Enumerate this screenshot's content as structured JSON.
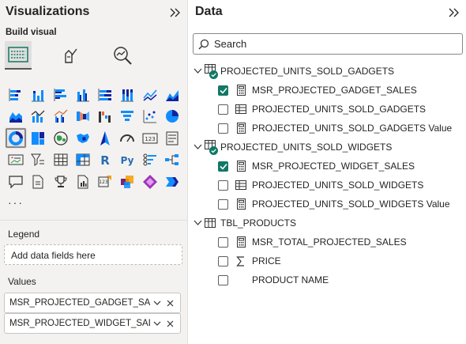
{
  "visualizations": {
    "title": "Visualizations",
    "build_visual_label": "Build visual",
    "more_label": "···",
    "legend": {
      "label": "Legend",
      "placeholder": "Add data fields here"
    },
    "values": {
      "label": "Values",
      "fields": [
        "MSR_PROJECTED_GADGET_SALES",
        "MSR_PROJECTED_WIDGET_SALES"
      ]
    },
    "selected_visual": "donut-chart-icon"
  },
  "data": {
    "title": "Data",
    "search_placeholder": "Search",
    "tables": [
      {
        "name": "PROJECTED_UNITS_SOLD_GADGETS",
        "fields": [
          {
            "label": "MSR_PROJECTED_GADGET_SALES",
            "type": "measure",
            "checked": true
          },
          {
            "label": "PROJECTED_UNITS_SOLD_GADGETS",
            "type": "table",
            "checked": false
          },
          {
            "label": "PROJECTED_UNITS_SOLD_GADGETS Value",
            "type": "measure",
            "checked": false
          }
        ]
      },
      {
        "name": "PROJECTED_UNITS_SOLD_WIDGETS",
        "fields": [
          {
            "label": "MSR_PROJECTED_WIDGET_SALES",
            "type": "measure",
            "checked": true
          },
          {
            "label": "PROJECTED_UNITS_SOLD_WIDGETS",
            "type": "table",
            "checked": false
          },
          {
            "label": "PROJECTED_UNITS_SOLD_WIDGETS Value",
            "type": "measure",
            "checked": false
          }
        ]
      },
      {
        "name": "TBL_PRODUCTS",
        "fields": [
          {
            "label": "MSR_TOTAL_PROJECTED_SALES",
            "type": "measure",
            "checked": false
          },
          {
            "label": "PRICE",
            "type": "sum",
            "checked": false
          },
          {
            "label": "PRODUCT NAME",
            "type": "none",
            "checked": false
          }
        ]
      }
    ]
  },
  "colors": {
    "accent": "#117865",
    "chart_blue": "#118dff",
    "chart_navy": "#12239e",
    "chart_orange": "#e66c37"
  }
}
